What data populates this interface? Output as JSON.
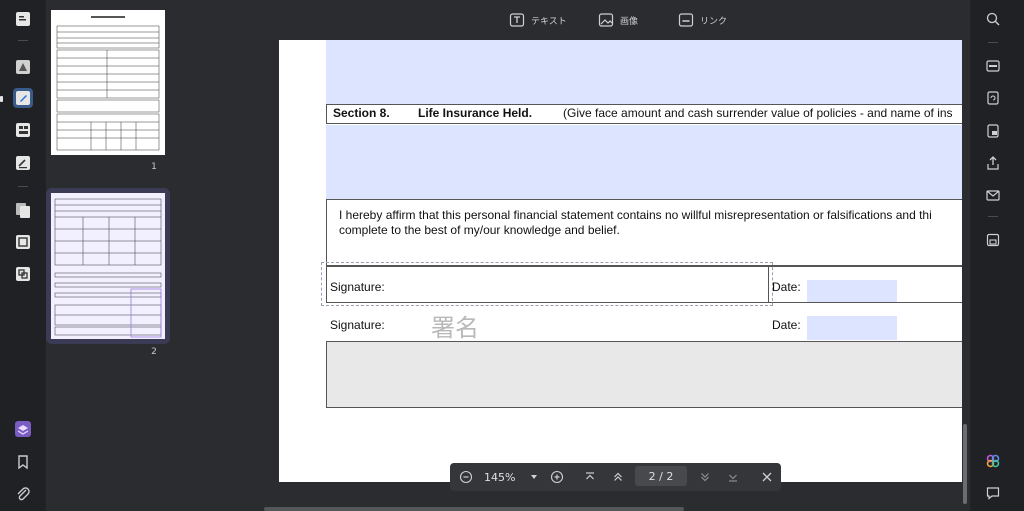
{
  "toolbar": {
    "text_label": "テキスト",
    "image_label": "画像",
    "link_label": "リンク"
  },
  "thumbnails": [
    {
      "label": "1"
    },
    {
      "label": "2"
    }
  ],
  "document": {
    "section_label": "Section 8.",
    "section_title": "Life Insurance Held.",
    "section_note": "(Give face amount and cash surrender value of policies - and name of ins",
    "affirm_line1": "I hereby affirm that this personal financial statement contains no willful misrepresentation or falsifications and thi",
    "affirm_line2": "complete to the best of my/our knowledge and belief.",
    "signature_label_1": "Signature:",
    "date_label_1": "Date:",
    "signature_label_2": "Signature:",
    "date_label_2": "Date:",
    "signature_hint": "署名"
  },
  "zoom": {
    "level": "145%",
    "page_indicator": "2 / 2"
  },
  "colors": {
    "accent": "#3a5a8a",
    "field_fill": "#dde4ff"
  }
}
